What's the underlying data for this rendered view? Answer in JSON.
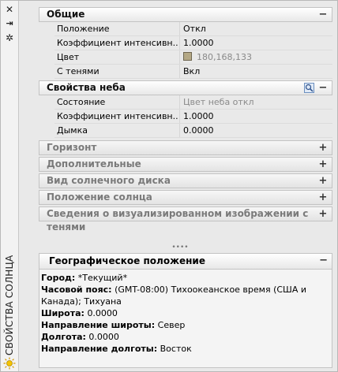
{
  "strip": {
    "close_glyph": "✕",
    "pin_glyph": "⇥",
    "settings_glyph": "✲",
    "title": "СВОЙСТВА СОЛНЦА"
  },
  "general": {
    "title": "Общие",
    "toggle": "−",
    "rows": [
      {
        "label": "Положение",
        "value": "Откл"
      },
      {
        "label": "Коэффициент интенсивн...",
        "value": "1.0000"
      },
      {
        "label": "Цвет",
        "value": "180,168,133"
      },
      {
        "label": "С тенями",
        "value": "Вкл"
      }
    ],
    "color_hex": "#b4a885"
  },
  "sky": {
    "title": "Свойства неба",
    "toggle": "−",
    "tool_icon": "zoom-window-icon",
    "rows": [
      {
        "label": "Состояние",
        "value": "Цвет неба откл"
      },
      {
        "label": "Коэффициент интенсивн...",
        "value": "1.0000"
      },
      {
        "label": "Дымка",
        "value": "0.0000"
      }
    ]
  },
  "collapsed_sections": [
    {
      "title": "Горизонт",
      "toggle": "+"
    },
    {
      "title": "Дополнительные",
      "toggle": "+"
    },
    {
      "title": "Вид солнечного диска",
      "toggle": "+"
    },
    {
      "title": "Положение солнца",
      "toggle": "+"
    },
    {
      "title": "Сведения о визуализированном изображении с тенями",
      "toggle": "+"
    }
  ],
  "geo": {
    "title": "Географическое положение",
    "toggle": "−",
    "city_label": "Город:",
    "city_value": "*Текущий*",
    "tz_label": "Часовой пояс:",
    "tz_value": "(GMT-08:00) Тихоокеанское время (США и Канада); Тихуана",
    "lat_label": "Широта:",
    "lat_value": "0.0000",
    "latdir_label": "Направление широты:",
    "latdir_value": "Север",
    "lon_label": "Долгота:",
    "lon_value": "0.0000",
    "londir_label": "Направление долготы:",
    "londir_value": "Восток"
  }
}
